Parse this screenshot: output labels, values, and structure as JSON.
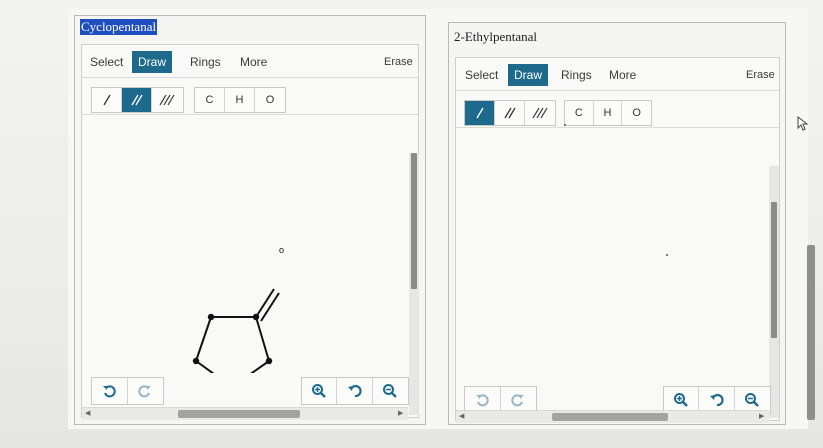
{
  "panels": [
    {
      "title": "Cyclopentanal",
      "tabs": [
        "Select",
        "Draw",
        "Rings",
        "More"
      ],
      "active_tab": "Draw",
      "erase_label": "Erase",
      "atoms": [
        "C",
        "H",
        "O"
      ],
      "bond_active": "double",
      "molecule_atom_label": "o"
    },
    {
      "title": "2-Ethylpentanal",
      "tabs": [
        "Select",
        "Draw",
        "Rings",
        "More"
      ],
      "active_tab": "Draw",
      "erase_label": "Erase",
      "atoms": [
        "C",
        "H",
        "O"
      ],
      "bond_active": "single"
    }
  ],
  "colors": {
    "accent": "#1d6a8c",
    "selection": "#1f4fbf"
  },
  "icons": [
    "single-bond-icon",
    "double-bond-icon",
    "triple-bond-icon",
    "undo-icon",
    "redo-icon",
    "zoom-in-icon",
    "reset-zoom-icon",
    "zoom-out-icon",
    "mouse-pointer-icon"
  ]
}
